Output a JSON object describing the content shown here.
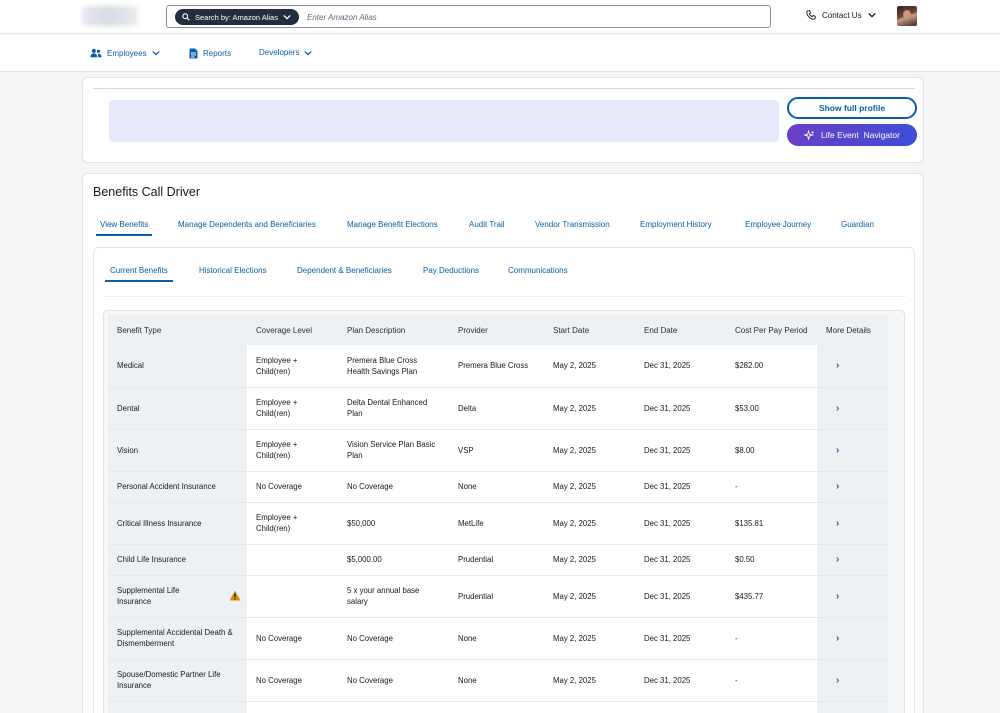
{
  "header": {
    "search_pill_label": "Search by: Amazon Alias",
    "search_placeholder": "Enter Amazon Alias",
    "contact_label": "Contact Us"
  },
  "nav": {
    "employees": "Employees",
    "reports": "Reports",
    "developers": "Developers"
  },
  "profile": {
    "show_full_profile": "Show full profile",
    "life_event_navigator": "Life Event  Navigator"
  },
  "main": {
    "title": "Benefits Call Driver",
    "tabs": [
      {
        "label": "View Benefits"
      },
      {
        "label": "Manage Dependents and Beneficiaries"
      },
      {
        "label": "Manage Benefit Elections"
      },
      {
        "label": "Audit Trail"
      },
      {
        "label": "Vendor Transmission"
      },
      {
        "label": "Employment History"
      },
      {
        "label": "Employee Journey"
      },
      {
        "label": "Guardian"
      }
    ],
    "subtabs": [
      {
        "label": "Current Benefits"
      },
      {
        "label": "Historical Elections"
      },
      {
        "label": "Dependent & Beneficiaries"
      },
      {
        "label": "Pay Deductions"
      },
      {
        "label": "Communications"
      }
    ]
  },
  "table": {
    "headers": {
      "benefit_type": "Benefit Type",
      "coverage_level": "Coverage Level",
      "plan_description": "Plan Description",
      "provider": "Provider",
      "start_date": "Start Date",
      "end_date": "End Date",
      "cost": "Cost Per Pay Period",
      "more": "More Details"
    },
    "rows": [
      {
        "type": "Medical",
        "coverage": "Employee + Child(ren)",
        "plan": "Premera Blue Cross Health Savings Plan",
        "provider": "Premera Blue Cross",
        "start": "May 2, 2025",
        "end": "Dec 31, 2025",
        "cost": "$282.00"
      },
      {
        "type": "Dental",
        "coverage": "Employee + Child(ren)",
        "plan": "Delta Dental Enhanced Plan",
        "provider": "Delta",
        "start": "May 2, 2025",
        "end": "Dec 31, 2025",
        "cost": "$53.00"
      },
      {
        "type": "Vision",
        "coverage": "Employee + Child(ren)",
        "plan": "Vision Service Plan Basic Plan",
        "provider": "VSP",
        "start": "May 2, 2025",
        "end": "Dec 31, 2025",
        "cost": "$8.00"
      },
      {
        "type": "Personal Accident Insurance",
        "coverage": "No Coverage",
        "plan": "No Coverage",
        "provider": "None",
        "start": "May 2, 2025",
        "end": "Dec 31, 2025",
        "cost": "-"
      },
      {
        "type": "Critical Illness Insurance",
        "coverage": "Employee + Child(ren)",
        "plan": "$50,000",
        "provider": "MetLife",
        "start": "May 2, 2025",
        "end": "Dec 31, 2025",
        "cost": "$135.81"
      },
      {
        "type": "Child Life Insurance",
        "coverage": "",
        "plan": "$5,000.00",
        "provider": "Prudential",
        "start": "May 2, 2025",
        "end": "Dec 31, 2025",
        "cost": "$0.50"
      },
      {
        "type": "Supplemental Life Insurance",
        "coverage": "",
        "plan": "5 x your annual base salary",
        "provider": "Prudential",
        "start": "May 2, 2025",
        "end": "Dec 31, 2025",
        "cost": "$435.77",
        "warning": true
      },
      {
        "type": "Supplemental Accidental Death & Dismemberment",
        "coverage": "No Coverage",
        "plan": "No Coverage",
        "provider": "None",
        "start": "May 2, 2025",
        "end": "Dec 31, 2025",
        "cost": "-"
      },
      {
        "type": "Spouse/Domestic Partner Life Insurance",
        "coverage": "No Coverage",
        "plan": "No Coverage",
        "provider": "None",
        "start": "May 2, 2025",
        "end": "Dec 31, 2025",
        "cost": "-"
      }
    ]
  },
  "colors": {
    "link_blue": "#0b5fa8",
    "dark_navy": "#232f3e",
    "banner_lavender": "#e6e9fc",
    "life_event_gradient_start": "#6b3fc8",
    "life_event_gradient_end": "#3d4dd6",
    "warning_orange": "#d99100"
  }
}
